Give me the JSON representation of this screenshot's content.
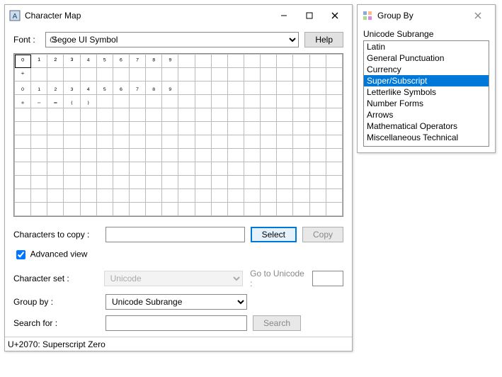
{
  "main": {
    "title": "Character Map",
    "font_label": "Font :",
    "font_value": "Segoe UI Symbol",
    "help_label": "Help",
    "grid": {
      "cols": 20,
      "rows": 12,
      "cells": [
        [
          "⁰",
          "¹",
          "²",
          "³",
          "⁴",
          "⁵",
          "⁶",
          "⁷",
          "⁸",
          "⁹",
          "",
          "",
          "",
          "",
          "",
          "",
          "",
          "",
          "",
          ""
        ],
        [
          "⁺",
          "",
          "",
          "",
          "",
          "",
          "",
          "",
          "",
          "",
          "",
          "",
          "",
          "",
          "",
          "",
          "",
          "",
          "",
          ""
        ],
        [
          "₀",
          "₁",
          "₂",
          "₃",
          "₄",
          "₅",
          "₆",
          "₇",
          "₈",
          "₉",
          "",
          "",
          "",
          "",
          "",
          "",
          "",
          "",
          "",
          ""
        ],
        [
          "₊",
          "₋",
          "₌",
          "₍",
          "₎",
          "",
          "",
          "",
          "",
          "",
          "",
          "",
          "",
          "",
          "",
          "",
          "",
          "",
          "",
          ""
        ],
        [
          "",
          "",
          "",
          "",
          "",
          "",
          "",
          "",
          "",
          "",
          "",
          "",
          "",
          "",
          "",
          "",
          "",
          "",
          "",
          ""
        ],
        [
          "",
          "",
          "",
          "",
          "",
          "",
          "",
          "",
          "",
          "",
          "",
          "",
          "",
          "",
          "",
          "",
          "",
          "",
          "",
          ""
        ],
        [
          "",
          "",
          "",
          "",
          "",
          "",
          "",
          "",
          "",
          "",
          "",
          "",
          "",
          "",
          "",
          "",
          "",
          "",
          "",
          ""
        ],
        [
          "",
          "",
          "",
          "",
          "",
          "",
          "",
          "",
          "",
          "",
          "",
          "",
          "",
          "",
          "",
          "",
          "",
          "",
          "",
          ""
        ],
        [
          "",
          "",
          "",
          "",
          "",
          "",
          "",
          "",
          "",
          "",
          "",
          "",
          "",
          "",
          "",
          "",
          "",
          "",
          "",
          ""
        ],
        [
          "",
          "",
          "",
          "",
          "",
          "",
          "",
          "",
          "",
          "",
          "",
          "",
          "",
          "",
          "",
          "",
          "",
          "",
          "",
          ""
        ],
        [
          "",
          "",
          "",
          "",
          "",
          "",
          "",
          "",
          "",
          "",
          "",
          "",
          "",
          "",
          "",
          "",
          "",
          "",
          "",
          ""
        ],
        [
          "",
          "",
          "",
          "",
          "",
          "",
          "",
          "",
          "",
          "",
          "",
          "",
          "",
          "",
          "",
          "",
          "",
          "",
          "",
          ""
        ]
      ],
      "selected": [
        0,
        0
      ]
    },
    "copy_label": "Characters to copy :",
    "copy_value": "",
    "select_btn": "Select",
    "copy_btn": "Copy",
    "adv_label": "Advanced view",
    "adv_checked": true,
    "charset_label": "Character set :",
    "charset_value": "Unicode",
    "goto_label": "Go to Unicode :",
    "goto_value": "",
    "groupby_label": "Group by :",
    "groupby_value": "Unicode Subrange",
    "search_label": "Search for :",
    "search_value": "",
    "search_btn": "Search",
    "status": "U+2070: Superscript Zero"
  },
  "groupby": {
    "title": "Group By",
    "subrange_label": "Unicode Subrange",
    "items": [
      "Latin",
      "General Punctuation",
      "Currency",
      "Super/Subscript",
      "Letterlike Symbols",
      "Number Forms",
      "Arrows",
      "Mathematical Operators",
      "Miscellaneous Technical"
    ],
    "selected_index": 3
  }
}
